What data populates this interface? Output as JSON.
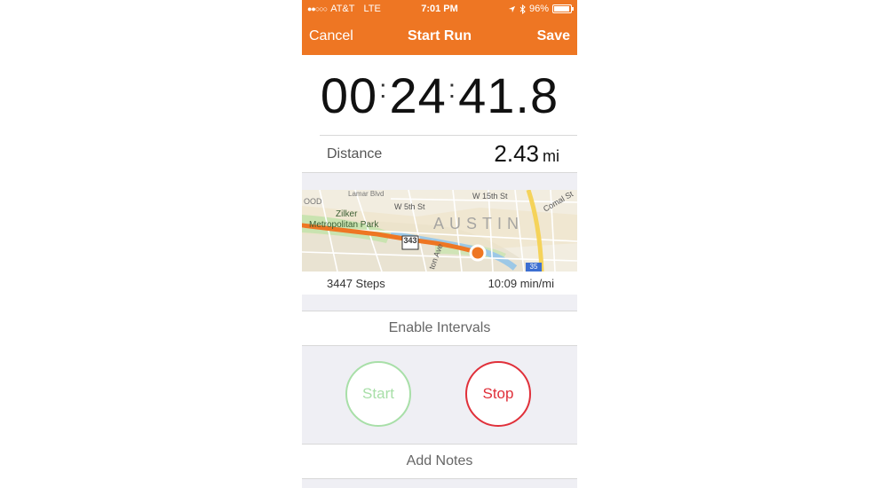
{
  "status": {
    "signal_dots": "●●○○○",
    "carrier": "AT&T",
    "network": "LTE",
    "time": "7:01 PM",
    "battery_text": "96%",
    "battery_level": 0.96
  },
  "nav": {
    "cancel": "Cancel",
    "title": "Start Run",
    "save": "Save"
  },
  "timer": {
    "hours": "00",
    "minutes": "24",
    "seconds": "41.8"
  },
  "distance": {
    "label": "Distance",
    "value": "2.43",
    "unit": "mi"
  },
  "map": {
    "labels": {
      "park_line1": "Zilker",
      "park_line2": "Metropolitan Park",
      "city": "AUSTIN",
      "street_w15": "W 15th St",
      "street_w5": "W 5th St",
      "street_comal": "Comal St",
      "area_left": "OOD",
      "highway_343": "343",
      "highway_35": "35",
      "street_lamar": "Lamar Blvd",
      "street_south": "ton Ave"
    },
    "route_color": "#ee7623"
  },
  "stats": {
    "steps": "3447 Steps",
    "pace": "10:09 min/mi"
  },
  "intervals": {
    "label": "Enable Intervals"
  },
  "controls": {
    "start": "Start",
    "stop": "Stop"
  },
  "notes": {
    "label": "Add Notes"
  },
  "colors": {
    "accent": "#ee7623",
    "start": "#a8dfa8",
    "stop": "#e0303a"
  }
}
